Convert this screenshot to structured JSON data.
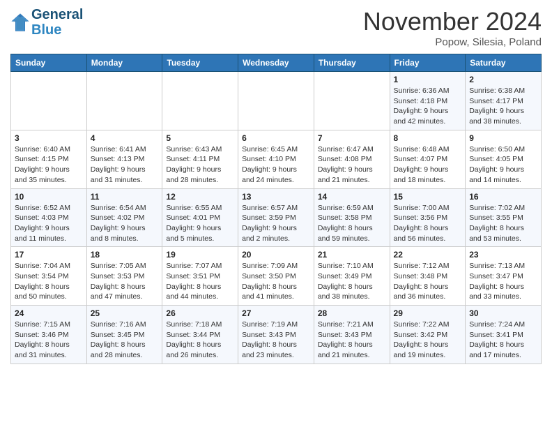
{
  "logo": {
    "line1": "General",
    "line2": "Blue"
  },
  "title": "November 2024",
  "location": "Popow, Silesia, Poland",
  "days_header": [
    "Sunday",
    "Monday",
    "Tuesday",
    "Wednesday",
    "Thursday",
    "Friday",
    "Saturday"
  ],
  "weeks": [
    [
      {
        "day": "",
        "info": ""
      },
      {
        "day": "",
        "info": ""
      },
      {
        "day": "",
        "info": ""
      },
      {
        "day": "",
        "info": ""
      },
      {
        "day": "",
        "info": ""
      },
      {
        "day": "1",
        "info": "Sunrise: 6:36 AM\nSunset: 4:18 PM\nDaylight: 9 hours\nand 42 minutes."
      },
      {
        "day": "2",
        "info": "Sunrise: 6:38 AM\nSunset: 4:17 PM\nDaylight: 9 hours\nand 38 minutes."
      }
    ],
    [
      {
        "day": "3",
        "info": "Sunrise: 6:40 AM\nSunset: 4:15 PM\nDaylight: 9 hours\nand 35 minutes."
      },
      {
        "day": "4",
        "info": "Sunrise: 6:41 AM\nSunset: 4:13 PM\nDaylight: 9 hours\nand 31 minutes."
      },
      {
        "day": "5",
        "info": "Sunrise: 6:43 AM\nSunset: 4:11 PM\nDaylight: 9 hours\nand 28 minutes."
      },
      {
        "day": "6",
        "info": "Sunrise: 6:45 AM\nSunset: 4:10 PM\nDaylight: 9 hours\nand 24 minutes."
      },
      {
        "day": "7",
        "info": "Sunrise: 6:47 AM\nSunset: 4:08 PM\nDaylight: 9 hours\nand 21 minutes."
      },
      {
        "day": "8",
        "info": "Sunrise: 6:48 AM\nSunset: 4:07 PM\nDaylight: 9 hours\nand 18 minutes."
      },
      {
        "day": "9",
        "info": "Sunrise: 6:50 AM\nSunset: 4:05 PM\nDaylight: 9 hours\nand 14 minutes."
      }
    ],
    [
      {
        "day": "10",
        "info": "Sunrise: 6:52 AM\nSunset: 4:03 PM\nDaylight: 9 hours\nand 11 minutes."
      },
      {
        "day": "11",
        "info": "Sunrise: 6:54 AM\nSunset: 4:02 PM\nDaylight: 9 hours\nand 8 minutes."
      },
      {
        "day": "12",
        "info": "Sunrise: 6:55 AM\nSunset: 4:01 PM\nDaylight: 9 hours\nand 5 minutes."
      },
      {
        "day": "13",
        "info": "Sunrise: 6:57 AM\nSunset: 3:59 PM\nDaylight: 9 hours\nand 2 minutes."
      },
      {
        "day": "14",
        "info": "Sunrise: 6:59 AM\nSunset: 3:58 PM\nDaylight: 8 hours\nand 59 minutes."
      },
      {
        "day": "15",
        "info": "Sunrise: 7:00 AM\nSunset: 3:56 PM\nDaylight: 8 hours\nand 56 minutes."
      },
      {
        "day": "16",
        "info": "Sunrise: 7:02 AM\nSunset: 3:55 PM\nDaylight: 8 hours\nand 53 minutes."
      }
    ],
    [
      {
        "day": "17",
        "info": "Sunrise: 7:04 AM\nSunset: 3:54 PM\nDaylight: 8 hours\nand 50 minutes."
      },
      {
        "day": "18",
        "info": "Sunrise: 7:05 AM\nSunset: 3:53 PM\nDaylight: 8 hours\nand 47 minutes."
      },
      {
        "day": "19",
        "info": "Sunrise: 7:07 AM\nSunset: 3:51 PM\nDaylight: 8 hours\nand 44 minutes."
      },
      {
        "day": "20",
        "info": "Sunrise: 7:09 AM\nSunset: 3:50 PM\nDaylight: 8 hours\nand 41 minutes."
      },
      {
        "day": "21",
        "info": "Sunrise: 7:10 AM\nSunset: 3:49 PM\nDaylight: 8 hours\nand 38 minutes."
      },
      {
        "day": "22",
        "info": "Sunrise: 7:12 AM\nSunset: 3:48 PM\nDaylight: 8 hours\nand 36 minutes."
      },
      {
        "day": "23",
        "info": "Sunrise: 7:13 AM\nSunset: 3:47 PM\nDaylight: 8 hours\nand 33 minutes."
      }
    ],
    [
      {
        "day": "24",
        "info": "Sunrise: 7:15 AM\nSunset: 3:46 PM\nDaylight: 8 hours\nand 31 minutes."
      },
      {
        "day": "25",
        "info": "Sunrise: 7:16 AM\nSunset: 3:45 PM\nDaylight: 8 hours\nand 28 minutes."
      },
      {
        "day": "26",
        "info": "Sunrise: 7:18 AM\nSunset: 3:44 PM\nDaylight: 8 hours\nand 26 minutes."
      },
      {
        "day": "27",
        "info": "Sunrise: 7:19 AM\nSunset: 3:43 PM\nDaylight: 8 hours\nand 23 minutes."
      },
      {
        "day": "28",
        "info": "Sunrise: 7:21 AM\nSunset: 3:43 PM\nDaylight: 8 hours\nand 21 minutes."
      },
      {
        "day": "29",
        "info": "Sunrise: 7:22 AM\nSunset: 3:42 PM\nDaylight: 8 hours\nand 19 minutes."
      },
      {
        "day": "30",
        "info": "Sunrise: 7:24 AM\nSunset: 3:41 PM\nDaylight: 8 hours\nand 17 minutes."
      }
    ]
  ]
}
